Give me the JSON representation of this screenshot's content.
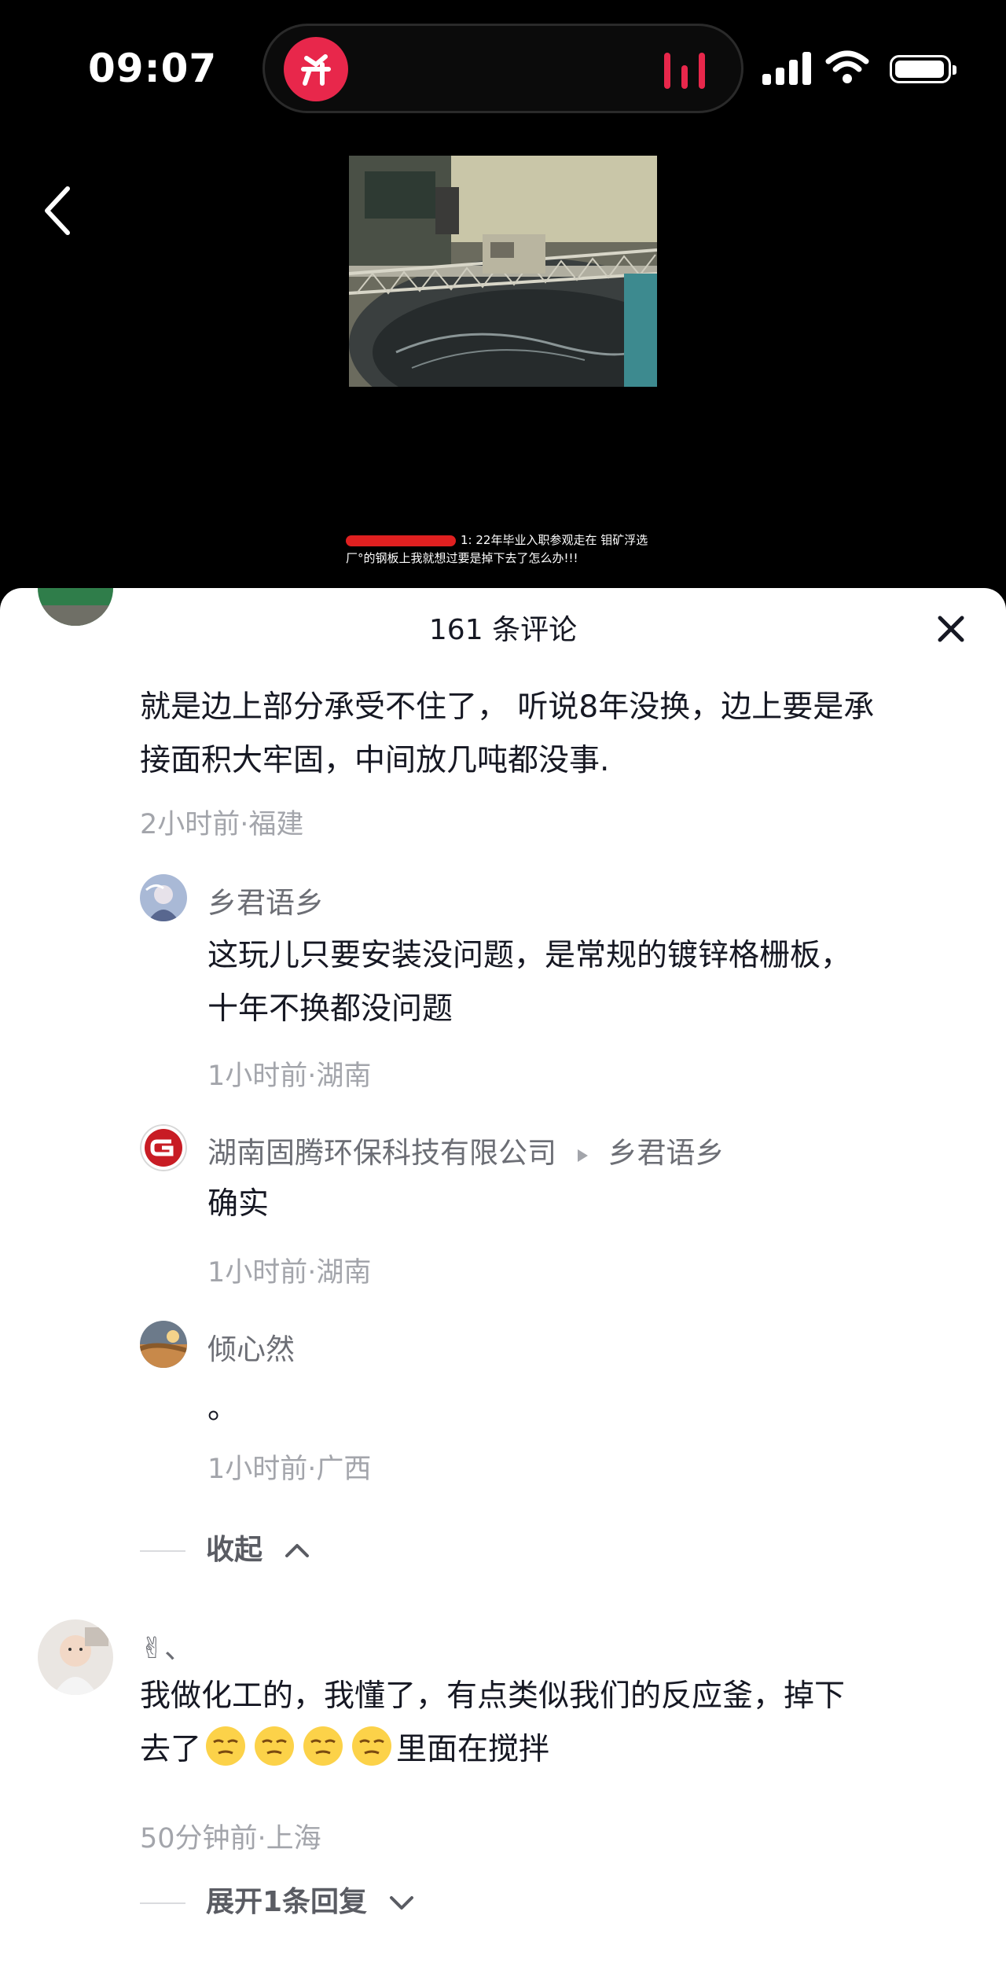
{
  "status": {
    "time": "09:07",
    "app_badge": "Ҥ"
  },
  "video": {
    "subtitle_line1": "1: 22年毕业入职参观走在 钼矿浮选",
    "subtitle_line2": "厂°的钢板上我就想过要是掉下去了怎么办!!!"
  },
  "sheet": {
    "title": "161 条评论"
  },
  "comments": [
    {
      "text_line1": "就是边上部分承受不住了，  听说8年没换，边上要是承",
      "text_line2": "接面积大牢固，中间放几吨都没事.",
      "meta": "2小时前·福建"
    },
    {
      "name": "乡君语乡",
      "text_line1": "这玩儿只要安装没问题，是常规的镀锌格栅板，",
      "text_line2": "十年不换都没问题",
      "meta": "1小时前·湖南"
    },
    {
      "name": "湖南固腾环保科技有限公司",
      "reply_to": "乡君语乡",
      "text": "确实",
      "meta": "1小时前·湖南"
    },
    {
      "name": "倾心然",
      "text": "。",
      "meta": "1小时前·广西"
    },
    {
      "name": "✌、",
      "text_line1": "我做化工的，我懂了，有点类似我们的反应釜，掉下",
      "text_line2_pre": "去了",
      "text_line2_post": "里面在搅拌",
      "meta": "50分钟前·上海"
    }
  ],
  "collapse_label": "收起",
  "expand_label": "展开1条回复"
}
